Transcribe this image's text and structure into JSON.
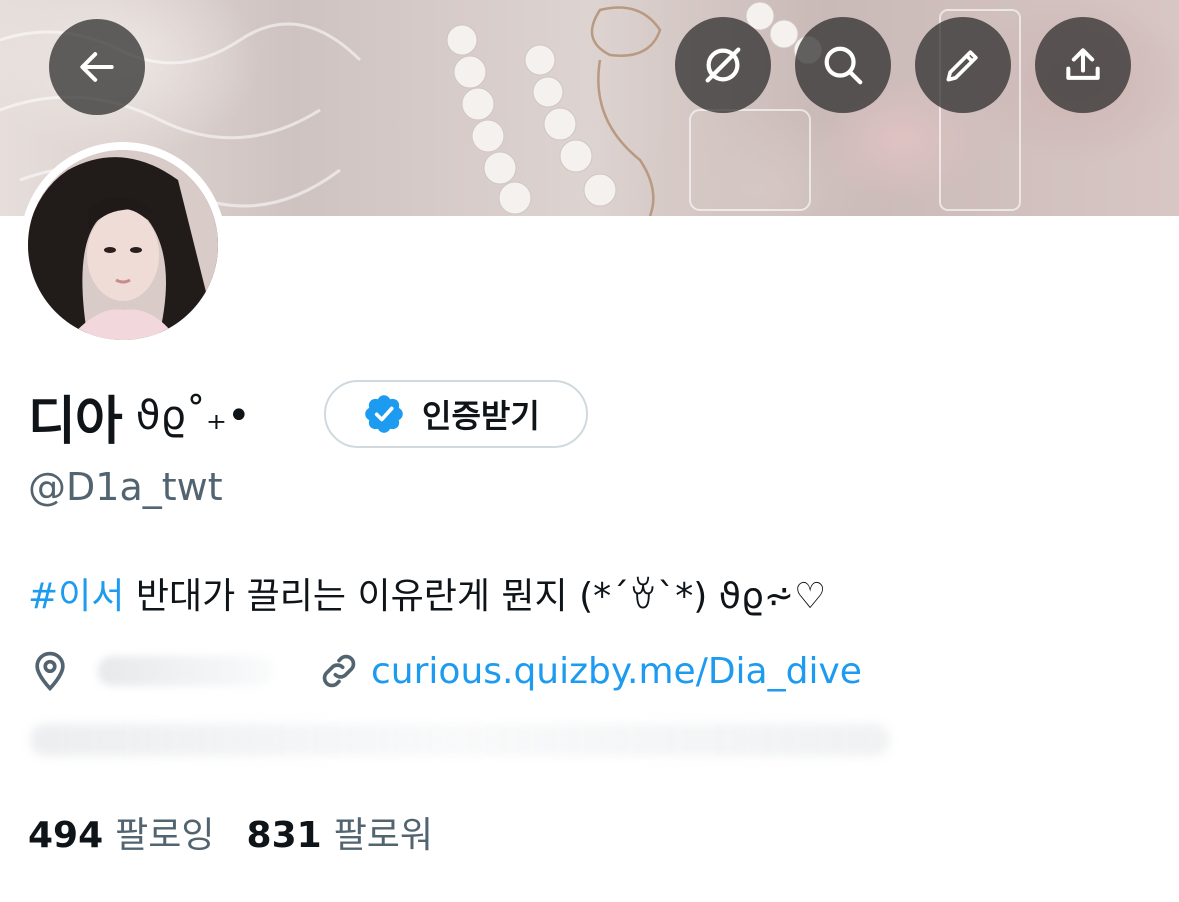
{
  "profile": {
    "display_name": "디아",
    "name_decoration": "ϑϱ˚₊•",
    "handle": "@D1a_twt",
    "verify_label": "인증받기",
    "bio": {
      "hashtag": "#이서",
      "text": " 반대가 끌리는 이유란게 뭔지 (*´ꈊ`*) ϑϱ⩫♡"
    },
    "link": "curious.quizby.me/Dia_dive",
    "following": {
      "count": "494",
      "label": "팔로잉"
    },
    "followers": {
      "count": "831",
      "label": "팔로워"
    }
  },
  "colors": {
    "accent": "#1d9bf0",
    "text": "#0f1419",
    "secondary": "#536471",
    "button_overlay": "rgba(40,40,40,0.72)"
  },
  "icons": [
    "back-arrow-icon",
    "circle-slash-icon",
    "search-icon",
    "pencil-icon",
    "share-icon",
    "verified-badge-icon",
    "location-pin-icon",
    "link-icon"
  ]
}
